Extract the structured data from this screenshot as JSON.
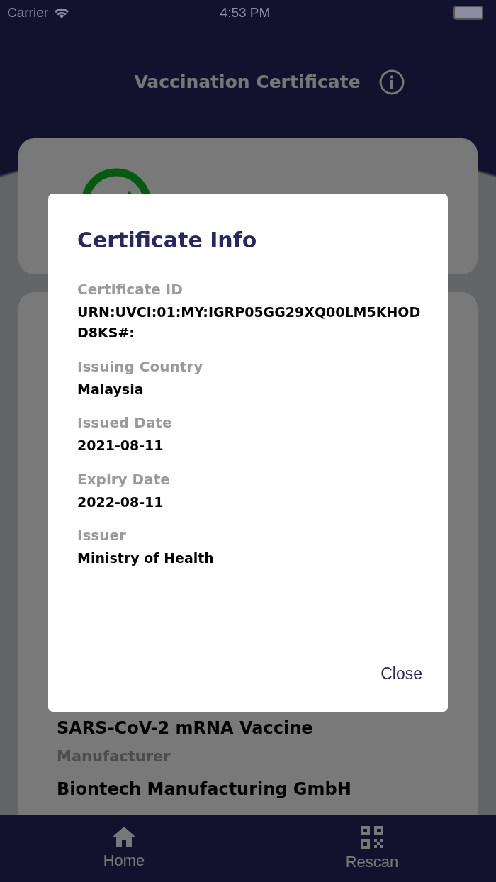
{
  "status_bar": {
    "carrier": "Carrier",
    "time": "4:53 PM"
  },
  "header": {
    "title": "Vaccination Certificate"
  },
  "status_card": {
    "valid": true
  },
  "details": [
    {
      "value": "SARS-CoV-2 mRNA Vaccine"
    },
    {
      "label": "Manufacturer",
      "value": "Biontech Manufacturing GmbH"
    }
  ],
  "dialog": {
    "title": "Certificate Info",
    "fields": [
      {
        "label": "Certificate ID",
        "value": "URN:UVCI:01:MY:IGRP05GG29XQ00LM5KHODD8KS#:"
      },
      {
        "label": "Issuing Country",
        "value": "Malaysia"
      },
      {
        "label": "Issued Date",
        "value": "2021-08-11"
      },
      {
        "label": "Expiry Date",
        "value": "2022-08-11"
      },
      {
        "label": "Issuer",
        "value": "Ministry of Health"
      }
    ],
    "close": "Close"
  },
  "tab_bar": [
    {
      "label": "Home",
      "kind": "home"
    },
    {
      "label": "Rescan",
      "kind": "qr"
    }
  ]
}
